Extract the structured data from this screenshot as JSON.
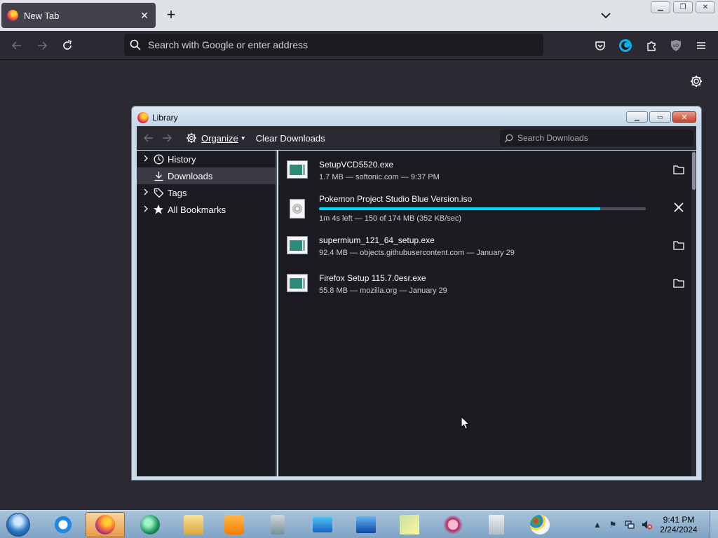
{
  "browser": {
    "tab_title": "New Tab",
    "urlbar_placeholder": "Search with Google or enter address"
  },
  "library": {
    "title": "Library",
    "toolbar": {
      "organize_label": "Organize",
      "clear_label": "Clear Downloads",
      "search_placeholder": "Search Downloads"
    },
    "sidebar": [
      {
        "label": "History",
        "icon": "clock-icon",
        "expandable": true
      },
      {
        "label": "Downloads",
        "icon": "download-icon",
        "expandable": false,
        "selected": true
      },
      {
        "label": "Tags",
        "icon": "tag-icon",
        "expandable": true
      },
      {
        "label": "All Bookmarks",
        "icon": "star-icon",
        "expandable": true
      }
    ],
    "downloads": [
      {
        "name": "SetupVCD5520.exe",
        "status": "1.7 MB — softonic.com — 9:37 PM",
        "icon": "exe-icon",
        "action": "folder-icon"
      },
      {
        "name": "Pokemon Project Studio Blue Version.iso",
        "status": "1m 4s left — 150 of 174 MB (352 KB/sec)",
        "icon": "iso-icon",
        "action": "cancel-icon",
        "progress": 0.86
      },
      {
        "name": "supermium_121_64_setup.exe",
        "status": "92.4 MB — objects.githubusercontent.com — January 29",
        "icon": "exe-icon",
        "action": "folder-icon"
      },
      {
        "name": "Firefox Setup 115.7.0esr.exe",
        "status": "55.8 MB — mozilla.org — January 29",
        "icon": "exe-icon",
        "action": "folder-icon"
      }
    ]
  },
  "taskbar": {
    "time": "9:41 PM",
    "date": "2/24/2024"
  },
  "colors": {
    "accent": "#00ddff",
    "chrome_dark": "#2b2a33",
    "list_bg": "#1c1b22"
  }
}
